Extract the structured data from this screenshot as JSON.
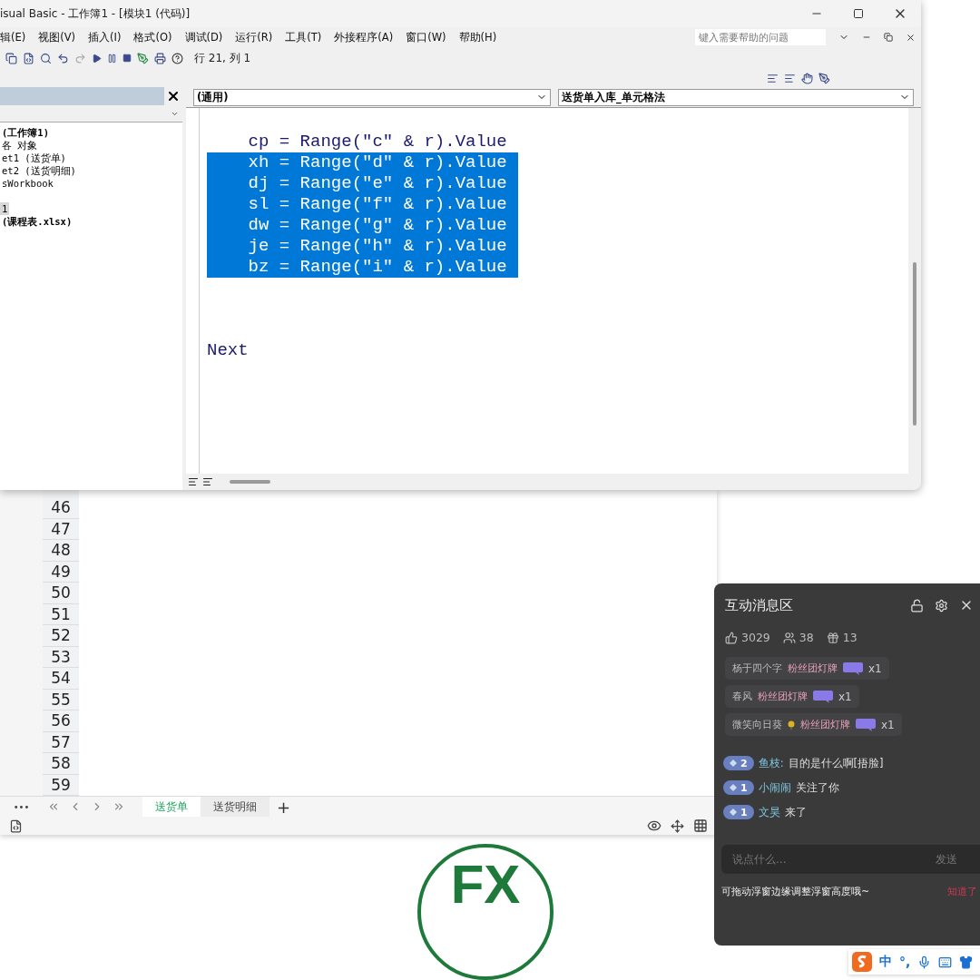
{
  "vbe": {
    "title": "isual Basic - 工作簿1 - [模块1 (代码)]",
    "menu": [
      "辑(E)",
      "视图(V)",
      "插入(I)",
      "格式(O)",
      "调试(D)",
      "运行(R)",
      "工具(T)",
      "外接程序(A)",
      "窗口(W)",
      "帮助(H)"
    ],
    "help_placeholder": "键入需要帮助的问题",
    "cursor_position": "行 21, 列 1",
    "project": [
      {
        "text": "(工作簿1)",
        "bold": true,
        "selected": false
      },
      {
        "text": "各 对象",
        "bold": false,
        "selected": false
      },
      {
        "text": "et1 (送货单)",
        "bold": false,
        "selected": false
      },
      {
        "text": "et2 (送货明细)",
        "bold": false,
        "selected": false
      },
      {
        "text": "sWorkbook",
        "bold": false,
        "selected": false
      },
      {
        "text": "1",
        "bold": false,
        "selected": true
      },
      {
        "text": "(课程表.xlsx)",
        "bold": true,
        "selected": false
      }
    ],
    "code": {
      "object_dropdown": "(通用)",
      "procedure_dropdown": "送货单入库_单元格法",
      "lines": [
        {
          "text": "    cp = Range(\"c\" & r).Value",
          "selected": false,
          "kind": "line"
        },
        {
          "text": "    xh = Range(\"d\" & r).Value",
          "selected": true,
          "kind": "line"
        },
        {
          "text": "    dj = Range(\"e\" & r).Value",
          "selected": true,
          "kind": "line"
        },
        {
          "text": "    sl = Range(\"f\" & r).Value",
          "selected": true,
          "kind": "line"
        },
        {
          "text": "    dw = Range(\"g\" & r).Value",
          "selected": true,
          "kind": "line"
        },
        {
          "text": "    je = Range(\"h\" & r).Value",
          "selected": true,
          "kind": "line"
        },
        {
          "text": "    bz = Range(\"i\" & r).Value",
          "selected": true,
          "kind": "line"
        },
        {
          "text": "Next",
          "selected": false,
          "kind": "after_gap"
        }
      ]
    }
  },
  "sheet": {
    "row_numbers": [
      "46",
      "47",
      "48",
      "49",
      "50",
      "51",
      "52",
      "53",
      "54",
      "55",
      "56",
      "57",
      "58",
      "59"
    ],
    "more": "•••",
    "tabs": [
      {
        "label": "送货单",
        "selected": true
      },
      {
        "label": "送货明细",
        "selected": false
      }
    ],
    "add_tab": "+"
  },
  "chat": {
    "title": "互动消息区",
    "stats": [
      {
        "kind": "likes",
        "value": "3029"
      },
      {
        "kind": "viewers",
        "value": "38"
      },
      {
        "kind": "gifts",
        "value": "13"
      }
    ],
    "gifts": [
      {
        "user": "杨于四个字",
        "flower": false,
        "gift": "粉丝团灯牌",
        "count": "x1"
      },
      {
        "user": "春风",
        "flower": false,
        "gift": "粉丝团灯牌",
        "count": "x1"
      },
      {
        "user": "微笑向日葵",
        "flower": true,
        "gift": "粉丝团灯牌",
        "count": "x1"
      }
    ],
    "messages": [
      {
        "level": "2",
        "user": "鱼枝:",
        "text": "目的是什么啊[捂脸]"
      },
      {
        "level": "1",
        "user": "小闹闹",
        "text": "关注了你"
      },
      {
        "level": "1",
        "user": "文昊",
        "text": "来了"
      }
    ],
    "input_placeholder": "说点什么...",
    "send": "发送",
    "tip": "可拖动浮窗边缘调整浮窗高度哦~",
    "tip_action": "知道了"
  },
  "ime": {
    "mode": "中",
    "punctuation": "°,"
  },
  "logo": {
    "text": "FX"
  }
}
